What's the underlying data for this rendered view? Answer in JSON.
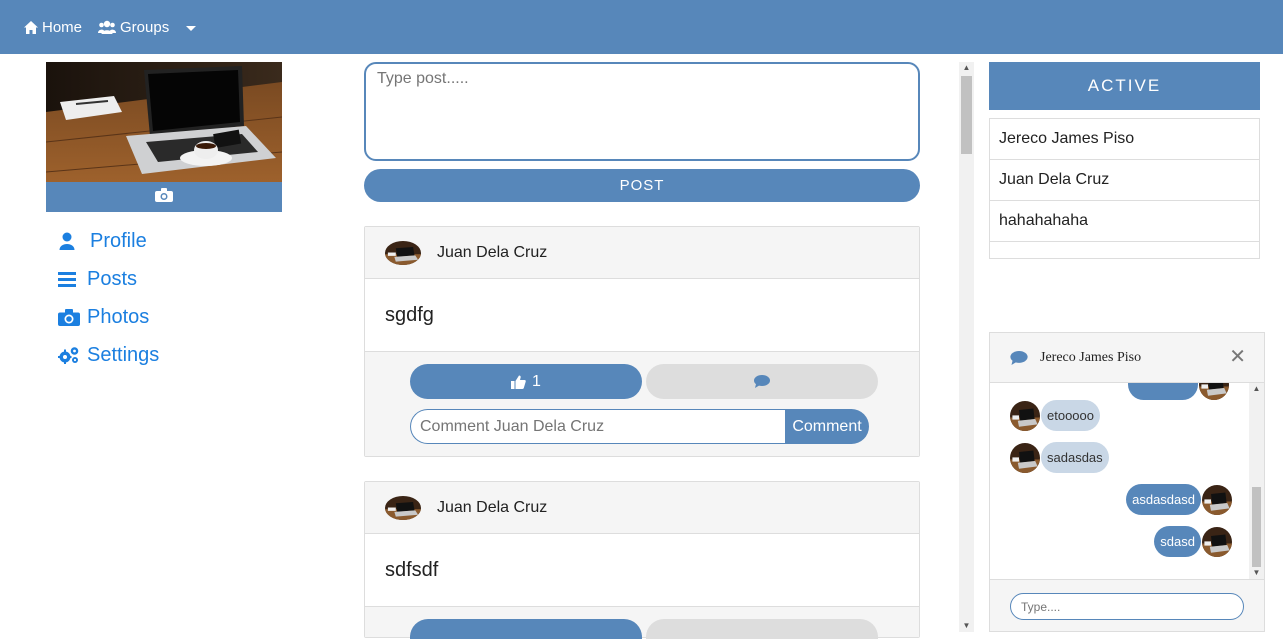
{
  "navbar": {
    "home_label": "Home",
    "groups_label": "Groups",
    "background": "#5787ba"
  },
  "sidebar": {
    "items": [
      {
        "label": "Profile",
        "icon": "user-icon"
      },
      {
        "label": "Posts",
        "icon": "bars-icon"
      },
      {
        "label": "Photos",
        "icon": "camera-icon"
      },
      {
        "label": "Settings",
        "icon": "cogs-icon"
      }
    ]
  },
  "composer": {
    "placeholder": "Type post.....",
    "post_label": "POST"
  },
  "posts": [
    {
      "author": "Juan Dela Cruz",
      "content": "sgdfg",
      "likes": "1",
      "comment_placeholder": "Comment Juan Dela Cruz",
      "comment_label": "Comment"
    },
    {
      "author": "Juan Dela Cruz",
      "content": "sdfsdf"
    }
  ],
  "active": {
    "title": "ACTIVE",
    "users": [
      "Jereco James Piso",
      "Juan Dela Cruz",
      "hahahahaha"
    ]
  },
  "chat": {
    "name": "Jereco James Piso",
    "close": "✕",
    "messages": [
      {
        "text": "etooooo",
        "direction": "in"
      },
      {
        "text": "sadasdas",
        "direction": "in"
      },
      {
        "text": "asdasdasd",
        "direction": "out"
      },
      {
        "text": "sdasd",
        "direction": "out"
      }
    ],
    "input_placeholder": "Type...."
  },
  "colors": {
    "accent": "#5787ba",
    "link": "#1b7fe0",
    "incoming_bubble": "#c9d7e6"
  }
}
